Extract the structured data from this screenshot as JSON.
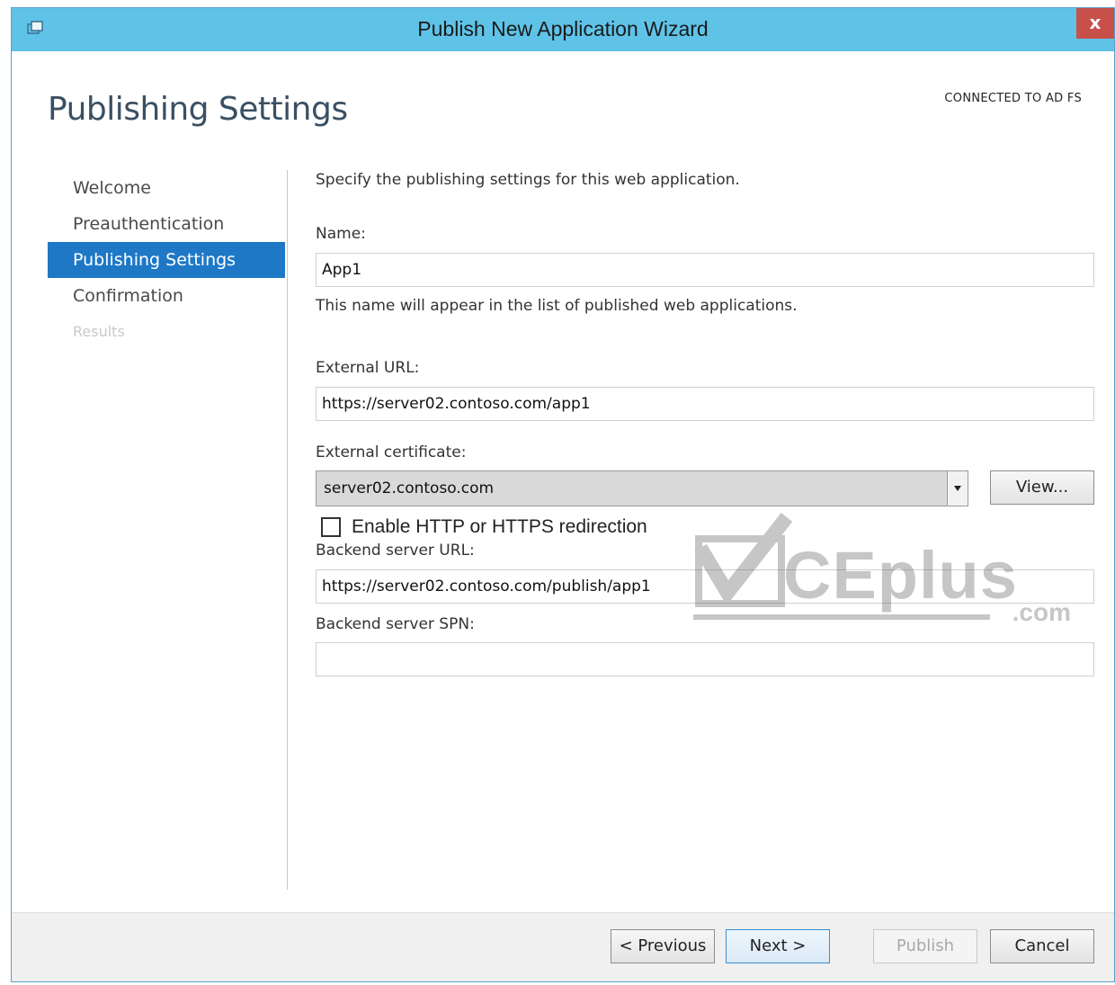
{
  "window": {
    "title": "Publish New Application Wizard",
    "close_label": "x"
  },
  "header": {
    "page_title": "Publishing Settings",
    "connection_status": "CONNECTED TO AD FS"
  },
  "nav": {
    "items": [
      {
        "label": "Welcome",
        "state": "normal"
      },
      {
        "label": "Preauthentication",
        "state": "normal"
      },
      {
        "label": "Publishing Settings",
        "state": "active"
      },
      {
        "label": "Confirmation",
        "state": "normal"
      },
      {
        "label": "Results",
        "state": "disabled"
      }
    ]
  },
  "form": {
    "instruction": "Specify the publishing settings for this web application.",
    "name_label": "Name:",
    "name_value": "App1",
    "name_hint": "This name will appear in the list of published web applications.",
    "external_url_label": "External URL:",
    "external_url_value": "https://server02.contoso.com/app1",
    "certificate_label": "External certificate:",
    "certificate_value": "server02.contoso.com",
    "view_button": "View...",
    "redirect_checkbox_label": "Enable HTTP or HTTPS redirection",
    "redirect_checked": false,
    "backend_url_label": "Backend server URL:",
    "backend_url_value": "https://server02.contoso.com/publish/app1",
    "backend_spn_label": "Backend server SPN:",
    "backend_spn_value": ""
  },
  "footer": {
    "previous_button": "< Previous",
    "next_button": "Next >",
    "publish_button": "Publish",
    "cancel_button": "Cancel"
  },
  "watermark": {
    "text": "CEplus",
    "sub": ".com"
  },
  "colors": {
    "titlebar": "#5fc3e8",
    "close_button": "#c7504b",
    "nav_active": "#1e78c6",
    "page_title": "#3a4f63"
  },
  "icons": {
    "app": "wizard-app-icon",
    "combo_arrow": "chevron-down-icon"
  }
}
